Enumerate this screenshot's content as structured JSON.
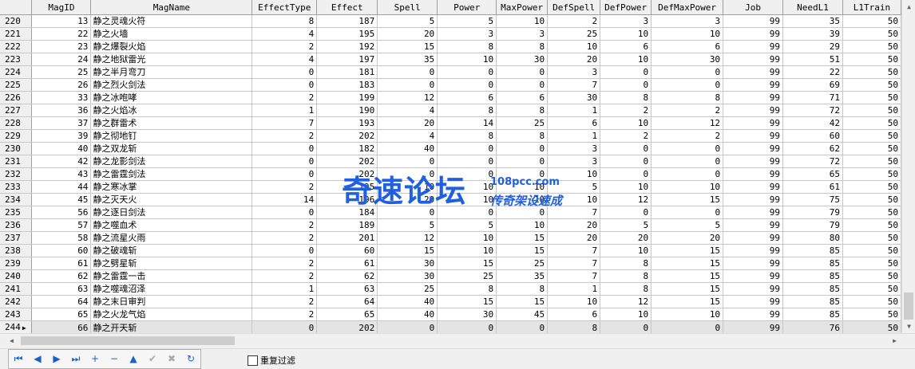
{
  "columns": [
    "",
    "MagID",
    "MagName",
    "EffectType",
    "Effect",
    "Spell",
    "Power",
    "MaxPower",
    "DefSpell",
    "DefPower",
    "DefMaxPower",
    "Job",
    "NeedL1",
    "L1Train"
  ],
  "current_row_marker": "▶",
  "current_row": 24,
  "rows": [
    [
      "220",
      "13",
      "静之灵魂火符",
      "8",
      "187",
      "5",
      "5",
      "10",
      "2",
      "3",
      "3",
      "99",
      "35",
      "50"
    ],
    [
      "221",
      "22",
      "静之火墙",
      "4",
      "195",
      "20",
      "3",
      "3",
      "25",
      "10",
      "10",
      "99",
      "39",
      "50"
    ],
    [
      "222",
      "23",
      "静之爆裂火焰",
      "2",
      "192",
      "15",
      "8",
      "8",
      "10",
      "6",
      "6",
      "99",
      "29",
      "50"
    ],
    [
      "223",
      "24",
      "静之地狱雷光",
      "4",
      "197",
      "35",
      "10",
      "30",
      "20",
      "10",
      "30",
      "99",
      "51",
      "50"
    ],
    [
      "224",
      "25",
      "静之半月弯刀",
      "0",
      "181",
      "0",
      "0",
      "0",
      "3",
      "0",
      "0",
      "99",
      "22",
      "50"
    ],
    [
      "225",
      "26",
      "静之烈火剑法",
      "0",
      "183",
      "0",
      "0",
      "0",
      "7",
      "0",
      "0",
      "99",
      "69",
      "50"
    ],
    [
      "226",
      "33",
      "静之冰咆哮",
      "2",
      "199",
      "12",
      "6",
      "6",
      "30",
      "8",
      "8",
      "99",
      "71",
      "50"
    ],
    [
      "227",
      "36",
      "静之火焰冰",
      "1",
      "190",
      "4",
      "8",
      "8",
      "1",
      "2",
      "2",
      "99",
      "72",
      "50"
    ],
    [
      "228",
      "37",
      "静之群雷术",
      "7",
      "193",
      "20",
      "14",
      "25",
      "6",
      "10",
      "12",
      "99",
      "42",
      "50"
    ],
    [
      "229",
      "39",
      "静之彻地钉",
      "2",
      "202",
      "4",
      "8",
      "8",
      "1",
      "2",
      "2",
      "99",
      "60",
      "50"
    ],
    [
      "230",
      "40",
      "静之双龙斩",
      "0",
      "182",
      "40",
      "0",
      "0",
      "3",
      "0",
      "0",
      "99",
      "62",
      "50"
    ],
    [
      "231",
      "42",
      "静之龙影剑法",
      "0",
      "202",
      "0",
      "0",
      "0",
      "3",
      "0",
      "0",
      "99",
      "72",
      "50"
    ],
    [
      "232",
      "43",
      "静之雷霆剑法",
      "0",
      "202",
      "0",
      "0",
      "0",
      "10",
      "0",
      "0",
      "99",
      "65",
      "50"
    ],
    [
      "233",
      "44",
      "静之寒冰掌",
      "2",
      "195",
      "10",
      "10",
      "10",
      "5",
      "10",
      "10",
      "99",
      "61",
      "50"
    ],
    [
      "234",
      "45",
      "静之灭天火",
      "14",
      "196",
      "20",
      "10",
      "10",
      "10",
      "12",
      "15",
      "99",
      "75",
      "50"
    ],
    [
      "235",
      "56",
      "静之逐日剑法",
      "0",
      "184",
      "0",
      "0",
      "0",
      "7",
      "0",
      "0",
      "99",
      "79",
      "50"
    ],
    [
      "236",
      "57",
      "静之噬血术",
      "2",
      "189",
      "5",
      "5",
      "10",
      "20",
      "5",
      "5",
      "99",
      "79",
      "50"
    ],
    [
      "237",
      "58",
      "静之流星火雨",
      "2",
      "201",
      "12",
      "10",
      "15",
      "20",
      "20",
      "20",
      "99",
      "80",
      "50"
    ],
    [
      "238",
      "60",
      "静之破魂斩",
      "0",
      "60",
      "15",
      "10",
      "15",
      "7",
      "10",
      "15",
      "99",
      "85",
      "50"
    ],
    [
      "239",
      "61",
      "静之劈星斩",
      "2",
      "61",
      "30",
      "15",
      "25",
      "7",
      "8",
      "15",
      "99",
      "85",
      "50"
    ],
    [
      "240",
      "62",
      "静之雷霆一击",
      "2",
      "62",
      "30",
      "25",
      "35",
      "7",
      "8",
      "15",
      "99",
      "85",
      "50"
    ],
    [
      "241",
      "63",
      "静之噬魂沼泽",
      "1",
      "63",
      "25",
      "8",
      "8",
      "1",
      "8",
      "15",
      "99",
      "85",
      "50"
    ],
    [
      "242",
      "64",
      "静之末日审判",
      "2",
      "64",
      "40",
      "15",
      "15",
      "10",
      "12",
      "15",
      "99",
      "85",
      "50"
    ],
    [
      "243",
      "65",
      "静之火龙气焰",
      "2",
      "65",
      "40",
      "30",
      "45",
      "6",
      "10",
      "10",
      "99",
      "85",
      "50"
    ],
    [
      "244",
      "66",
      "静之开天斩",
      "0",
      "202",
      "0",
      "0",
      "0",
      "8",
      "0",
      "0",
      "99",
      "76",
      "50"
    ]
  ],
  "navigator": {
    "buttons": [
      {
        "name": "first-record",
        "glyph": "⏮",
        "enabled": true
      },
      {
        "name": "prior-record",
        "glyph": "◀",
        "enabled": true
      },
      {
        "name": "next-record",
        "glyph": "▶",
        "enabled": true
      },
      {
        "name": "last-record",
        "glyph": "⏭",
        "enabled": true
      },
      {
        "name": "insert-record",
        "glyph": "+",
        "enabled": true
      },
      {
        "name": "delete-record",
        "glyph": "−",
        "enabled": true
      },
      {
        "name": "edit-record",
        "glyph": "▲",
        "enabled": true
      },
      {
        "name": "post-edit",
        "glyph": "✔",
        "enabled": false
      },
      {
        "name": "cancel-edit",
        "glyph": "✖",
        "enabled": false
      },
      {
        "name": "refresh-data",
        "glyph": "↻",
        "enabled": true
      }
    ]
  },
  "filter": {
    "label": "重复过滤",
    "checked": false
  },
  "watermark": {
    "main": "奇速论坛",
    "url": "108pcc.com",
    "sub": "传奇架设速成"
  }
}
